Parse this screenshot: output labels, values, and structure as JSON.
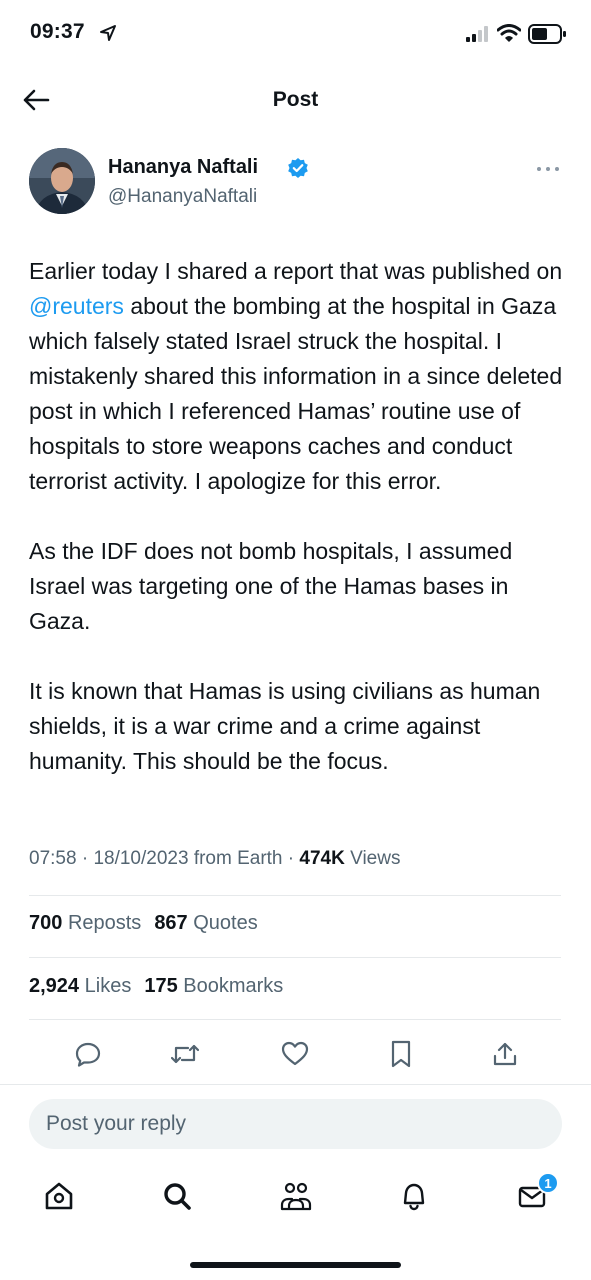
{
  "status_bar": {
    "time": "09:37",
    "icons": [
      "location-arrow-icon",
      "signal-icon",
      "wifi-icon",
      "battery-icon"
    ]
  },
  "header": {
    "title": "Post",
    "back_icon": "arrow-left-icon"
  },
  "author": {
    "name": "Hananya Naftali",
    "handle": "@HananyaNaftali",
    "verified": true,
    "verified_color": "#1d9bf0"
  },
  "post": {
    "paragraph1_pre": "Earlier today I shared a report that was published on ",
    "mention": "@reuters",
    "paragraph1_post": " about the bombing at the hospital in Gaza which falsely stated Israel struck the hospital. I mistakenly shared this information in a since deleted post in which I referenced Hamas’ routine use of hospitals to store weapons caches and conduct terrorist activity. I apologize for this error.",
    "paragraph2": "As the IDF does not bomb hospitals, I assumed Israel was targeting one of the Hamas bases in Gaza.",
    "paragraph3": "It is known that Hamas is using civilians as human shields, it is a war crime and a crime against humanity. This should be the focus."
  },
  "meta": {
    "time": "07:58",
    "date": "18/10/2023",
    "source": "from Earth",
    "views_count": "474K",
    "views_label": "Views",
    "separator": "·"
  },
  "stats": {
    "reposts_count": "700",
    "reposts_label": "Reposts",
    "quotes_count": "867",
    "quotes_label": "Quotes",
    "likes_count": "2,924",
    "likes_label": "Likes",
    "bookmarks_count": "175",
    "bookmarks_label": "Bookmarks"
  },
  "actions": [
    "reply-icon",
    "repost-icon",
    "like-icon",
    "bookmark-icon",
    "share-icon"
  ],
  "reply": {
    "placeholder": "Post your reply"
  },
  "tabbar": {
    "items": [
      "home-icon",
      "search-icon",
      "communities-icon",
      "notifications-icon",
      "messages-icon"
    ],
    "messages_badge": "1"
  },
  "colors": {
    "accent": "#1d9bf0",
    "text": "#0f1419",
    "secondary": "#536471",
    "divider": "#e6e9eb"
  }
}
